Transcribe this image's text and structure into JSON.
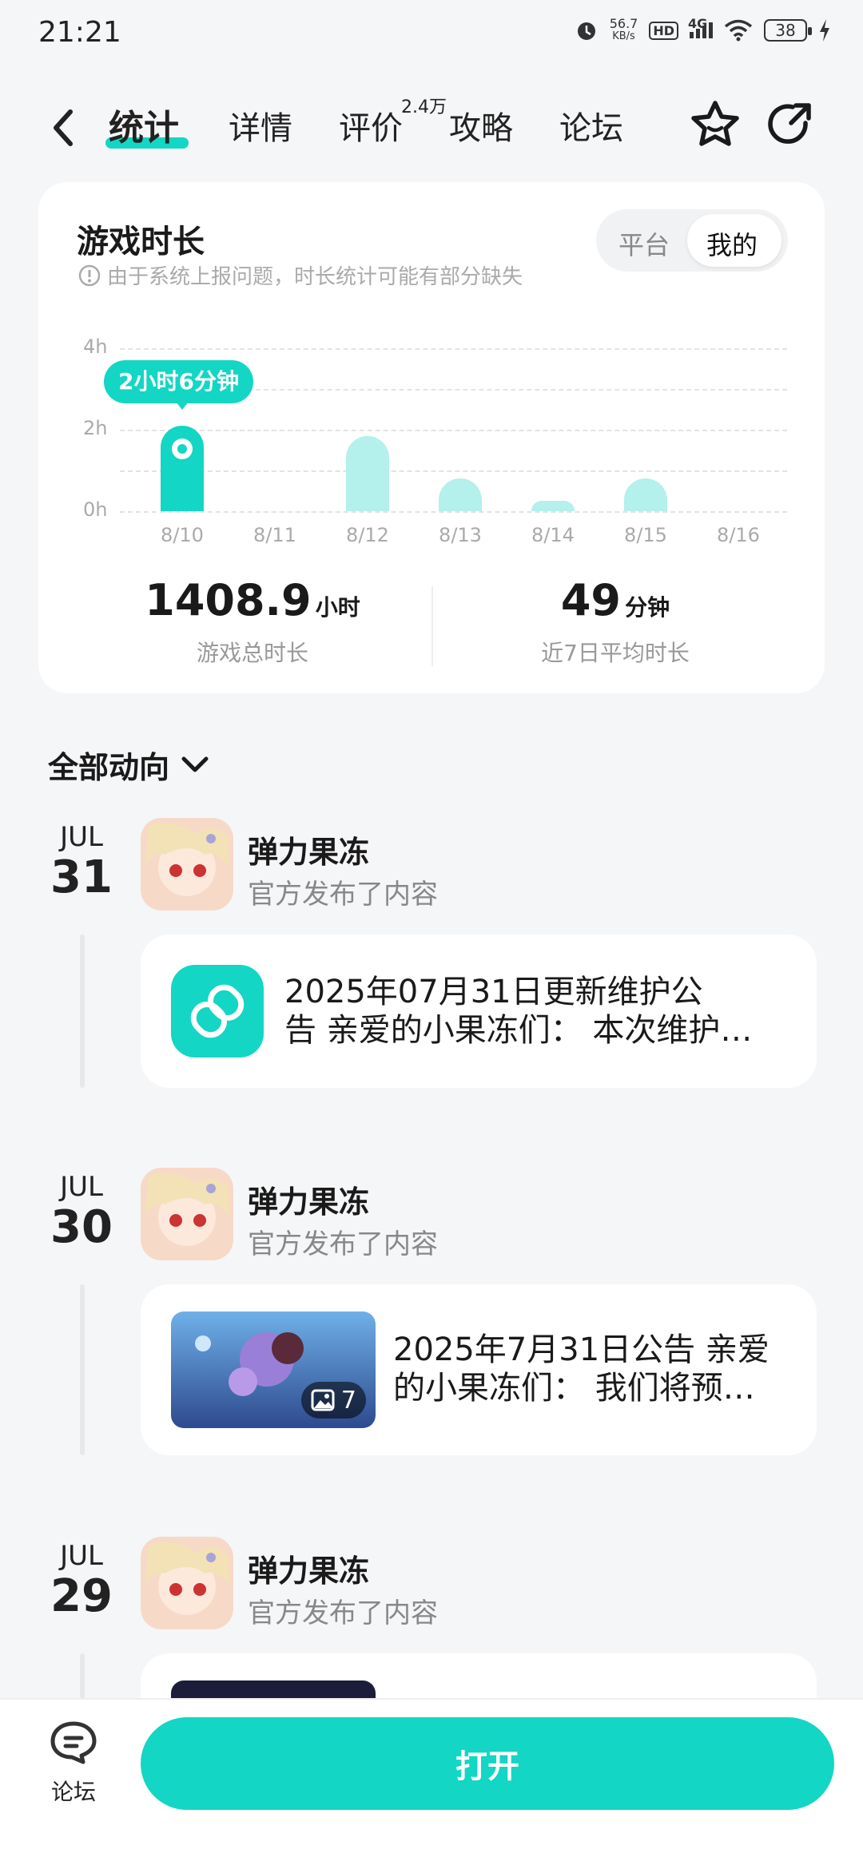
{
  "status_bar": {
    "time": "21:21",
    "net_speed_value": "56.7",
    "net_speed_unit": "KB/s",
    "hd": "HD",
    "network": "4G",
    "battery": "38"
  },
  "nav": {
    "tabs": [
      {
        "label": "统计"
      },
      {
        "label": "详情"
      },
      {
        "label": "评价"
      },
      {
        "label": "攻略"
      },
      {
        "label": "论坛"
      }
    ],
    "review_badge": "2.4万",
    "accent": "#13d6c4"
  },
  "playtime_card": {
    "title": "游戏时长",
    "notice": "由于系统上报问题，时长统计可能有部分缺失",
    "toggle": {
      "options": [
        "平台",
        "我的"
      ],
      "selected": "我的"
    },
    "tooltip": "2小时6分钟",
    "total_value": "1408.9",
    "total_unit": "小时",
    "total_label": "游戏总时长",
    "avg_value": "49",
    "avg_unit": "分钟",
    "avg_label": "近7日平均时长"
  },
  "chart_data": {
    "type": "bar",
    "categories": [
      "8/10",
      "8/11",
      "8/12",
      "8/13",
      "8/14",
      "8/15",
      "8/16"
    ],
    "values": [
      2.1,
      0,
      1.85,
      0.8,
      0.25,
      0.8,
      0
    ],
    "y_ticks": [
      "0h",
      "2h",
      "4h"
    ],
    "ylim": [
      0,
      4
    ],
    "grid": true,
    "highlighted_index": 0,
    "bar_color": "#b4f0ec",
    "highlight_color": "#13d6c4"
  },
  "feed": {
    "filter_label": "全部动向",
    "items": [
      {
        "month": "JUL",
        "day": "31",
        "author": "弹力果冻",
        "action": "官方发布了内容",
        "text_line1": "2025年07月31日更新维护公",
        "text_line2": "告 亲爱的小果冻们： 本次维护…",
        "kind": "link"
      },
      {
        "month": "JUL",
        "day": "30",
        "author": "弹力果冻",
        "action": "官方发布了内容",
        "text_line1": "2025年7月31日公告 亲爱",
        "text_line2": "的小果冻们： 我们将预…",
        "kind": "image",
        "image_count": "7"
      },
      {
        "month": "JUL",
        "day": "29",
        "author": "弹力果冻",
        "action": "官方发布了内容"
      }
    ]
  },
  "bottom_bar": {
    "forum_label": "论坛",
    "open_button": "打开"
  }
}
